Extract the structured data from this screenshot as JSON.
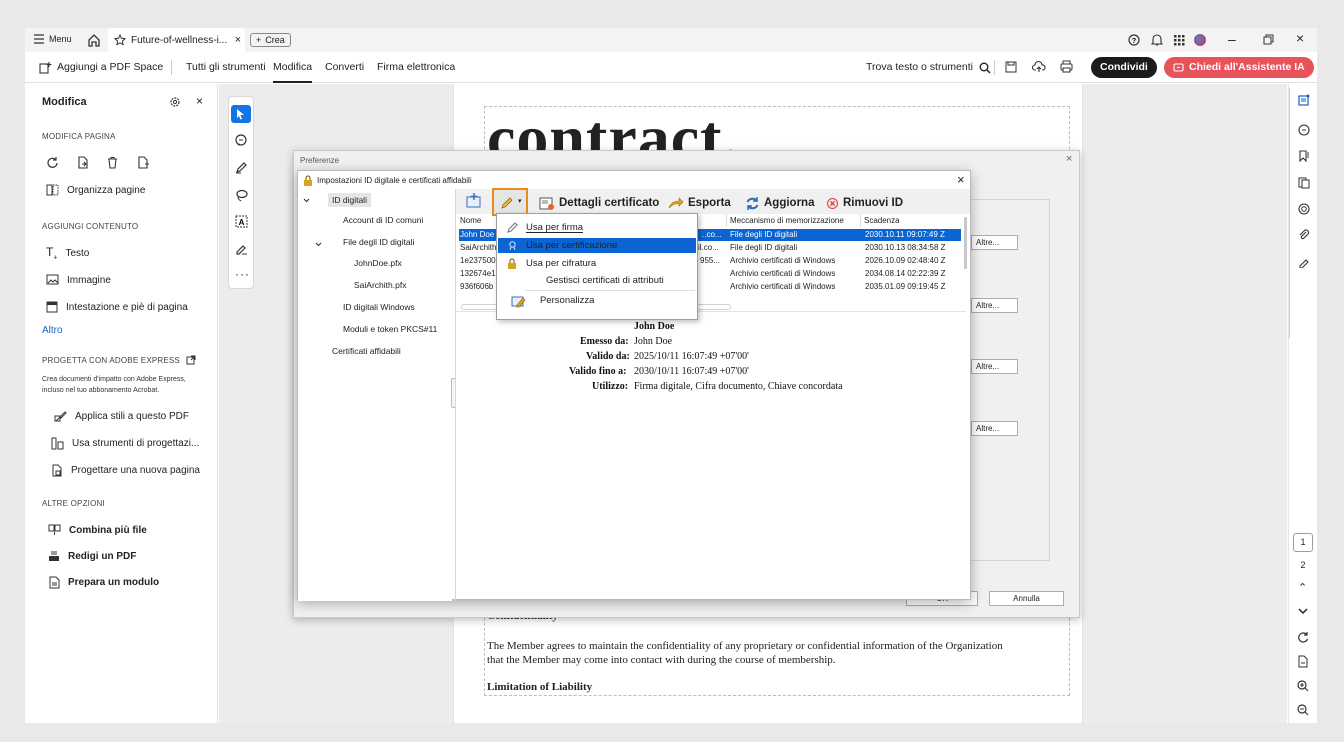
{
  "titlebar": {
    "menu_label": "Menu",
    "tab_title": "Future-of-wellness-i...",
    "new_tab_label": "Crea"
  },
  "toolbar": {
    "add_space": "Aggiungi a PDF Space",
    "all_tools": "Tutti gli strumenti",
    "edit": "Modifica",
    "convert": "Converti",
    "esign": "Firma elettronica",
    "find": "Trova testo o strumenti",
    "share": "Condividi",
    "ai_assistant": "Chiedi all'Assistente IA"
  },
  "left_panel": {
    "title": "Modifica",
    "sections": {
      "edit_page": "MODIFICA PAGINA",
      "organize": "Organizza pagine",
      "add_content": "AGGIUNGI CONTENUTO",
      "text": "Testo",
      "image": "Immagine",
      "header_footer": "Intestazione e piè di pagina",
      "more": "Altro",
      "express_head": "PROGETTA CON ADOBE EXPRESS",
      "express_desc_1": "Crea documenti d'impatto con Adobe Express,",
      "express_desc_2": "incluso nel tuo abbonamento Acrobat.",
      "apply_styles": "Applica stili a questo PDF",
      "design_tools": "Usa strumenti di progettazi...",
      "new_page": "Progettare una nuova pagina",
      "other_options": "ALTRE OPZIONI",
      "combine": "Combina più file",
      "redact": "Redigi un PDF",
      "prepare_form": "Prepara un modulo"
    }
  },
  "document": {
    "heading": "contract.",
    "section_confidentiality": "Confidentiality",
    "para_1": "The Member agrees to maintain the confidentiality of any proprietary or confidential information of the Organization",
    "para_2": "that the Member may come into contact with during the course of membership.",
    "section_liability": "Limitation of Liability"
  },
  "page_nav": {
    "page_current": "1",
    "page_next": "2"
  },
  "preferences_dialog": {
    "title": "Preferenze",
    "more_buttons": [
      "Altre...",
      "Altre...",
      "Altre...",
      "Altre..."
    ],
    "ok_label": "OK",
    "cancel_label": "Annulla"
  },
  "id_dialog": {
    "title": "Impostazioni ID digitale e certificati affidabili",
    "tree": {
      "digital_ids": "ID digitali",
      "roaming": "Account di ID comuni",
      "id_files": "File degli ID digitali",
      "file_1": "JohnDoe.pfx",
      "file_2": "SaiArchith.pfx",
      "windows_ids": "ID digitali Windows",
      "pkcs": "Moduli e token PKCS#11",
      "trusted": "Certificati affidabili"
    },
    "buttons": {
      "details": "Dettagli certificato",
      "export": "Esporta",
      "refresh": "Aggiorna",
      "remove": "Rimuovi ID"
    },
    "columns": {
      "name": "Nome",
      "storage": "Meccanismo di memorizzazione",
      "expiry": "Scadenza"
    },
    "rows": [
      {
        "name": "John Doe",
        "mid": "..co...",
        "storage": "File degli ID digitali",
        "expiry": "2030.10.11 09:07:49 Z"
      },
      {
        "name": "SaiArchith",
        "mid": "il.co...",
        "storage": "File degli ID digitali",
        "expiry": "2030.10.13 08:34:58 Z"
      },
      {
        "name": "1e237500",
        "mid": "955...",
        "storage": "Archivio certificati di Windows",
        "expiry": "2026.10.09 02:48:40 Z"
      },
      {
        "name": "132674e1",
        "mid": "",
        "storage": "Archivio certificati di Windows",
        "expiry": "2034.08.14 02:22:39 Z"
      },
      {
        "name": "936f606b",
        "mid": "",
        "storage": "Archivio certificati di Windows",
        "expiry": "2035.01.09 09:19:45 Z"
      }
    ],
    "context_menu": {
      "sign": "Usa per firma",
      "certify": "Usa per certificazione",
      "encrypt": "Usa per cifratura",
      "attributes": "Gestisci certificati di attributi",
      "customize": "Personalizza"
    },
    "details": {
      "name": "John Doe",
      "issued_label": "Emesso da:",
      "issued": "John Doe",
      "valid_from_label": "Valido da:",
      "valid_from": "2025/10/11 16:07:49 +07'00'",
      "valid_to_label": "Valido fino a:",
      "valid_to": "2030/10/11 16:07:49 +07'00'",
      "usage_label": "Utilizzo:",
      "usage": "Firma digitale, Cifra documento, Chiave concordata"
    }
  }
}
